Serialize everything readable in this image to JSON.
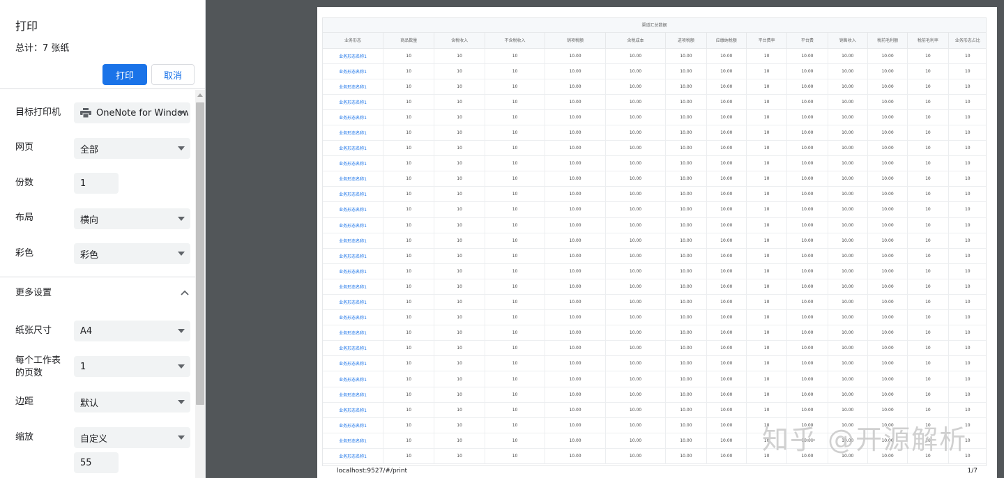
{
  "panel": {
    "title": "打印",
    "sheet_count": "总计：7 张纸",
    "print_label": "打印",
    "cancel_label": "取消"
  },
  "settings": {
    "destination_label": "目标打印机",
    "destination_value": "OneNote for Windows",
    "destination_icon": "printer-icon",
    "pages_label": "网页",
    "pages_value": "全部",
    "copies_label": "份数",
    "copies_value": "1",
    "layout_label": "布局",
    "layout_value": "横向",
    "color_label": "彩色",
    "color_value": "彩色",
    "more_label": "更多设置",
    "more_icon": "chevron-up-icon",
    "paper_label": "纸张尺寸",
    "paper_value": "A4",
    "pps_label_1": "每个工作表",
    "pps_label_2": "的页数",
    "pps_value": "1",
    "margins_label": "边距",
    "margins_value": "默认",
    "scale_label": "缩放",
    "scale_value": "自定义",
    "scale_custom": "55"
  },
  "preview": {
    "table_title": "渠道汇总数据",
    "columns": [
      "业务形态",
      "商品数量",
      "含税收入",
      "不含税收入",
      "销项税额",
      "含税成本",
      "进项税额",
      "应缴纳税额",
      "平台费率",
      "平台费",
      "销售收入",
      "税前毛利额",
      "税前毛利率",
      "业务形态占比"
    ],
    "row": [
      "业务形态名称1",
      "10",
      "10",
      "10",
      "10.00",
      "10.00",
      "10.00",
      "10.00",
      "10",
      "10.00",
      "10.00",
      "10.00",
      "10",
      "10"
    ],
    "row_count": 27,
    "footer_url": "localhost:9527/#/print",
    "footer_page": "1/7"
  },
  "watermark": "知乎 @开源解析",
  "colors": {
    "accent": "#1a73e8",
    "viewer_bg": "#525659",
    "control_bg": "#f1f3f4"
  }
}
